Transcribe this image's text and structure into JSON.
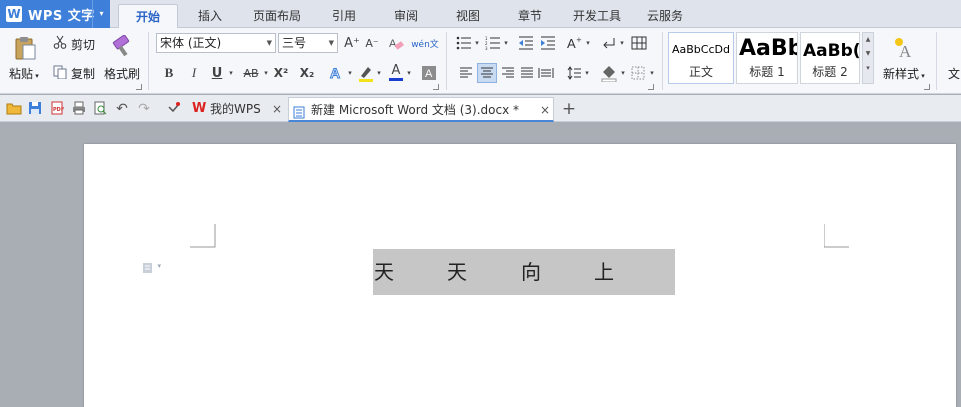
{
  "app": {
    "logo": "W",
    "title": "WPS 文字",
    "arrow": "▾"
  },
  "menu_tabs": [
    "开始",
    "插入",
    "页面布局",
    "引用",
    "审阅",
    "视图",
    "章节",
    "开发工具",
    "云服务"
  ],
  "ribbon": {
    "paste_label": "粘贴",
    "cut_label": "剪切",
    "copy_label": "复制",
    "format_painter_label": "格式刷",
    "font_name": "宋体 (正文)",
    "font_size": "三号",
    "bold": "B",
    "italic": "I",
    "underline": "U",
    "strikethrough": "AB",
    "superscript": "X²",
    "subscript": "X₂",
    "font_color_glyph": "A",
    "grow_font": "A⁺",
    "shrink_font": "A⁻",
    "phonetic": "wén文",
    "styles": [
      {
        "sample": "AaBbCcDd",
        "name": "正文"
      },
      {
        "sample": "AaBb",
        "name": "标题 1"
      },
      {
        "sample": "AaBb(",
        "name": "标题 2"
      }
    ],
    "new_style_label": "新样式",
    "more_label": "文"
  },
  "doc_tabs": {
    "home_label": "我的WPS",
    "active_label": "新建 Microsoft Word 文档 (3).docx *",
    "close_glyph": "×",
    "add_glyph": "+"
  },
  "document": {
    "chars": [
      "天",
      "天",
      "向",
      "上"
    ]
  },
  "colors": {
    "accent": "#3d7fd9",
    "highlight": "#c6c6c6",
    "font_color_bar": "#1a3fcf",
    "highlight_bar": "#f2e21c"
  }
}
